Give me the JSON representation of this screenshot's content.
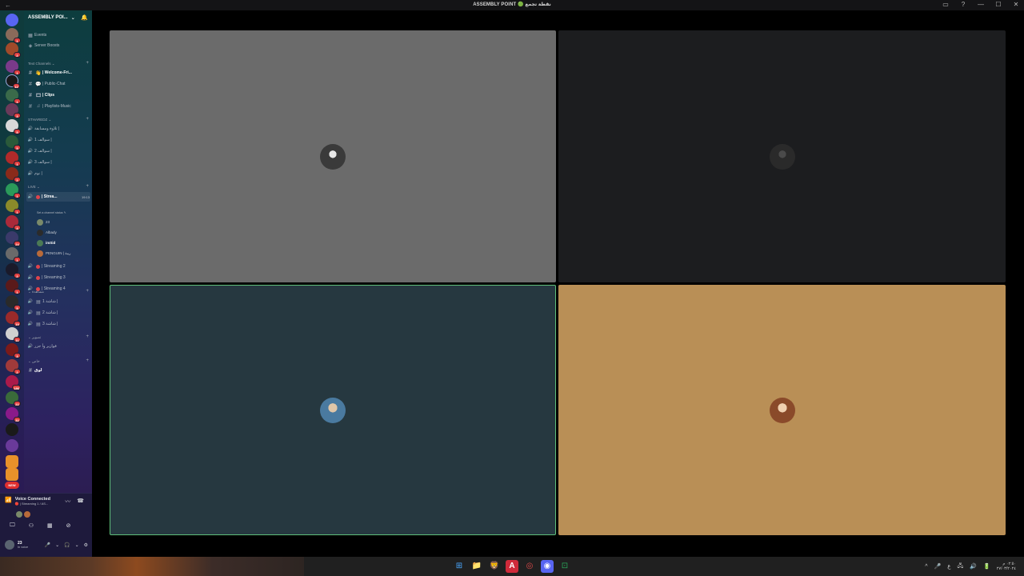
{
  "window": {
    "title": "ASSEMBLY POINT 🟢 نقطة تجمع",
    "back_glyph": "←",
    "controls": [
      "▭",
      "?",
      "—",
      "☐",
      "✕"
    ]
  },
  "server_rail": {
    "new_label": "NEW",
    "badges": [
      "1",
      "2",
      "1",
      "12",
      "1",
      "3",
      "5",
      "5",
      "1",
      "2",
      "1",
      "1",
      "4",
      "24",
      "1",
      "2",
      "1",
      "5",
      "19",
      "11",
      "3",
      "2",
      "186",
      "22",
      "32"
    ]
  },
  "guild": {
    "name": "ASSEMBLY POI...",
    "chevron": "⌄",
    "bell": "🔔"
  },
  "top_items": [
    {
      "icon": "▦",
      "label": "Events"
    },
    {
      "icon": "◈",
      "label": "Server Boosts"
    }
  ],
  "categories": {
    "text": "Text Channels ⌄",
    "stharedz": "STHAREDZ ⌄",
    "live": "LIVE ⌄",
    "watch": "⌄ مشاهدة",
    "photos": "⌄ تصوير",
    "private": "⌄ خاص",
    "plus": "+"
  },
  "text_channels": [
    {
      "label": "| Welcome-Fri...",
      "bold": true
    },
    {
      "label": "| Public-Chat",
      "bold": false
    },
    {
      "label": "| Clips",
      "bold": true
    },
    {
      "label": "| Playlists-Music",
      "bold": false
    }
  ],
  "voice_channels_1": [
    {
      "label": "تلاوة ومسابقة |"
    },
    {
      "label": "سوالف 1 |"
    },
    {
      "label": "سوالف 2 |"
    },
    {
      "label": "سوالف 3 |"
    },
    {
      "label": "نوم |"
    }
  ],
  "live": {
    "channel": "| Strea...",
    "time": "19:13",
    "status_hint": "Set a channel status ✎",
    "members": [
      {
        "name": "23",
        "color": "#7a8a6a"
      },
      {
        "name": "Albady",
        "color": "#2b2b2b"
      },
      {
        "name": "imSid",
        "color": "#4b7a55"
      },
      {
        "name": "PENGUIN | ريبة",
        "color": "#b86a3a"
      }
    ],
    "others": [
      {
        "label": "| Streaming 2"
      },
      {
        "label": "| Streaming 3"
      },
      {
        "label": "| Streaming 4"
      }
    ]
  },
  "watch_channels": [
    {
      "label": "شاشة 1 |"
    },
    {
      "label": "شاشة 2 |"
    },
    {
      "label": "شاشة 3 |"
    }
  ],
  "photo_channels": [
    {
      "label": "فوازير وأ جزر"
    }
  ],
  "private_channels": [
    {
      "label": "لوق"
    }
  ],
  "voice_panel": {
    "title": "Voice Connected",
    "subtitle": "🔴 | Streaming 1 / AS...",
    "icons": [
      "〰",
      "☎"
    ],
    "actions": [
      "🖵",
      "⚇",
      "▦",
      "⊘"
    ]
  },
  "user": {
    "name": "23",
    "status": "In voice",
    "controls": [
      "🎤",
      "⌄",
      "🎧",
      "⌄",
      "⚙"
    ]
  },
  "tiles": [
    {
      "id": "t1",
      "bg": "#6b6b6b",
      "avatar": "#3a3a3a"
    },
    {
      "id": "t2",
      "bg": "#1c1d1f",
      "avatar": "#2a2a2a"
    },
    {
      "id": "t3",
      "bg": "#263840",
      "avatar": "#4a7aa0"
    },
    {
      "id": "t4",
      "bg": "#b98f56",
      "avatar": "#8a4a2a"
    }
  ],
  "taskbar": {
    "apps": [
      "⊞",
      "📁",
      "🦁",
      "A",
      "◎",
      "◉",
      "⊡"
    ],
    "tray": [
      "^",
      "🎤",
      "ع",
      "🖧",
      "🔊",
      "🔋"
    ],
    "clock_time": "٠٢:٥٠ م",
    "clock_date": "٢٧/٠٣/٢٠٢٤"
  }
}
